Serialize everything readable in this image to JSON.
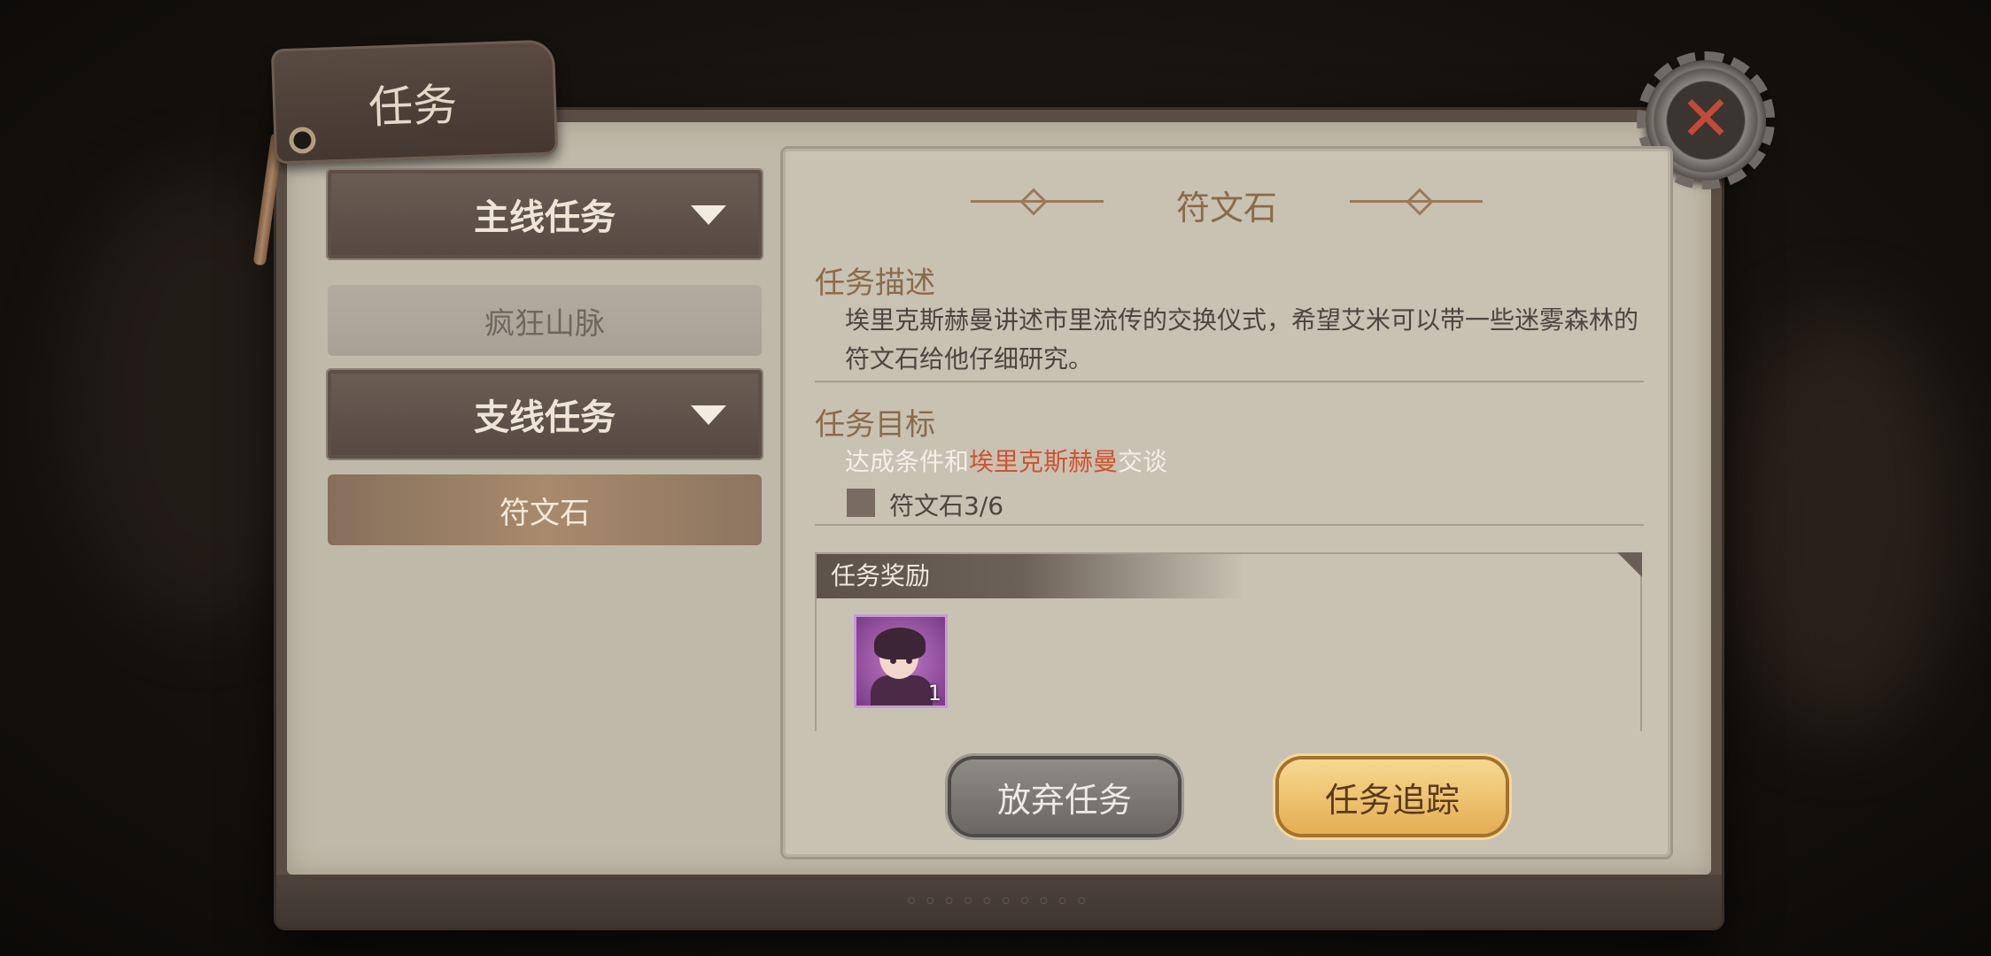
{
  "window": {
    "tag_title": "任务"
  },
  "sidebar": {
    "main_category": "主线任务",
    "main_items": [
      "疯狂山脉"
    ],
    "side_category": "支线任务",
    "side_items": [
      "符文石"
    ],
    "selected_item": "符文石"
  },
  "quest": {
    "title": "符文石",
    "description_heading": "任务描述",
    "description": "埃里克斯赫曼讲述市里流传的交换仪式，希望艾米可以带一些迷雾森林的符文石给他仔细研究。",
    "objective_heading": "任务目标",
    "objective_prefix": "达成条件和",
    "objective_npc": "埃里克斯赫曼",
    "objective_suffix": "交谈",
    "progress_label": "符文石3/6",
    "progress": {
      "current": 3,
      "total": 6
    },
    "reward_heading": "任务奖励",
    "reward_count": "1"
  },
  "buttons": {
    "abandon": "放弃任务",
    "track": "任务追踪"
  },
  "colors": {
    "accent_title": "#8b6a4a",
    "npc_highlight": "#d0532f",
    "track_button": "#e5ad52",
    "close_x": "#c24a38"
  },
  "icons": {
    "close": "close-x-gear-icon",
    "dropdown": "chevron-down-icon",
    "checkbox": "checkbox-icon",
    "reward": "character-portrait-icon"
  }
}
